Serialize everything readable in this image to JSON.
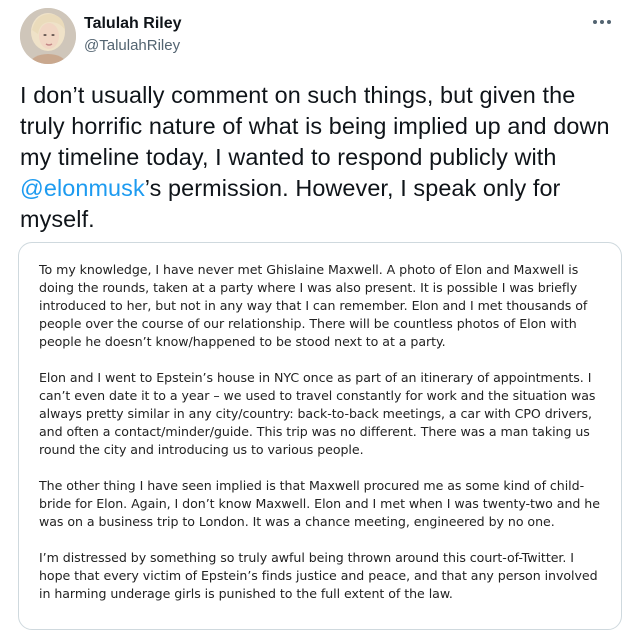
{
  "author": {
    "display_name": "Talulah Riley",
    "handle": "@TalulahRiley"
  },
  "icons": {
    "more": "more-horizontal-icon"
  },
  "tweet": {
    "text_before": "I don’t usually comment on such things, but given the truly horrific nature of what is being implied up and down my timeline today, I wanted to respond publicly with ",
    "mention": "@elonmusk",
    "text_after": "’s permission. However, I speak only for myself."
  },
  "statement": {
    "paragraphs": [
      "To my knowledge, I have never met Ghislaine Maxwell. A photo of Elon and Maxwell is doing the rounds, taken at a party where I was also present. It is possible I was briefly introduced to her, but not in any way that I can remember. Elon and I met thousands of people over the course of our relationship. There will be countless photos of Elon with people he doesn’t know/happened to be stood next to at a party.",
      "Elon and I went to Epstein’s house in NYC once as part of an itinerary of appointments. I can’t even date it to a year – we used to travel constantly for work and the situation was always pretty similar in any city/country: back-to-back meetings, a car with CPO drivers, and often a contact/minder/guide. This trip was no different. There was a man taking us round the city and introducing us to various people.",
      "The other thing I have seen implied is that Maxwell procured me as some kind of child-bride for Elon. Again, I don’t know Maxwell. Elon and I met when I was twenty-two and he was on a business trip to London. It was a chance meeting, engineered by no one.",
      "I’m distressed by something so truly awful being thrown around this court-of-Twitter. I hope that every victim of Epstein’s finds justice and peace, and that any person involved in harming underage girls is punished to the full extent of the law."
    ]
  },
  "colors": {
    "text": "#0f1419",
    "secondary": "#536471",
    "link": "#1d9bf0",
    "border": "#cfd9de"
  }
}
